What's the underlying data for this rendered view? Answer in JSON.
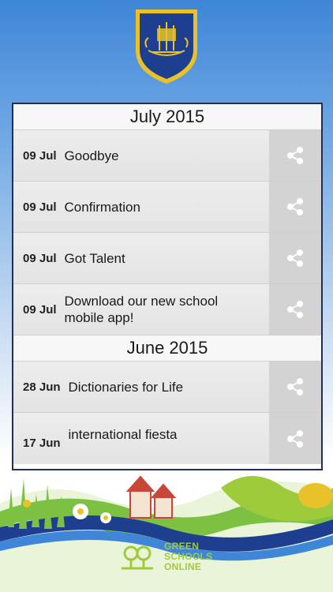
{
  "sections": [
    {
      "month": "July 2015",
      "items": [
        {
          "date": "09 Jul",
          "title": "Goodbye"
        },
        {
          "date": "09 Jul",
          "title": "Confirmation"
        },
        {
          "date": "09 Jul",
          "title": "Got Talent"
        },
        {
          "date": "09 Jul",
          "title": "Download our new school mobile app!"
        }
      ]
    },
    {
      "month": "June 2015",
      "items": [
        {
          "date": "28 Jun",
          "title": "Dictionaries for Life"
        },
        {
          "date": "17 Jun",
          "title": "international fiesta"
        }
      ]
    }
  ],
  "brand": {
    "line1": "GREEN",
    "line2": "SCHOOLS",
    "line3": "ONLINE"
  },
  "icons": {
    "share": "share-icon",
    "crest": "school-crest-icon",
    "brand_logo": "green-schools-logo-icon"
  },
  "colors": {
    "panel_border": "#1f2f55",
    "share_bg": "#d3d3d3",
    "crest_blue": "#1e3f8f",
    "crest_gold": "#e8c228",
    "brand_green": "#9ecb3c"
  }
}
